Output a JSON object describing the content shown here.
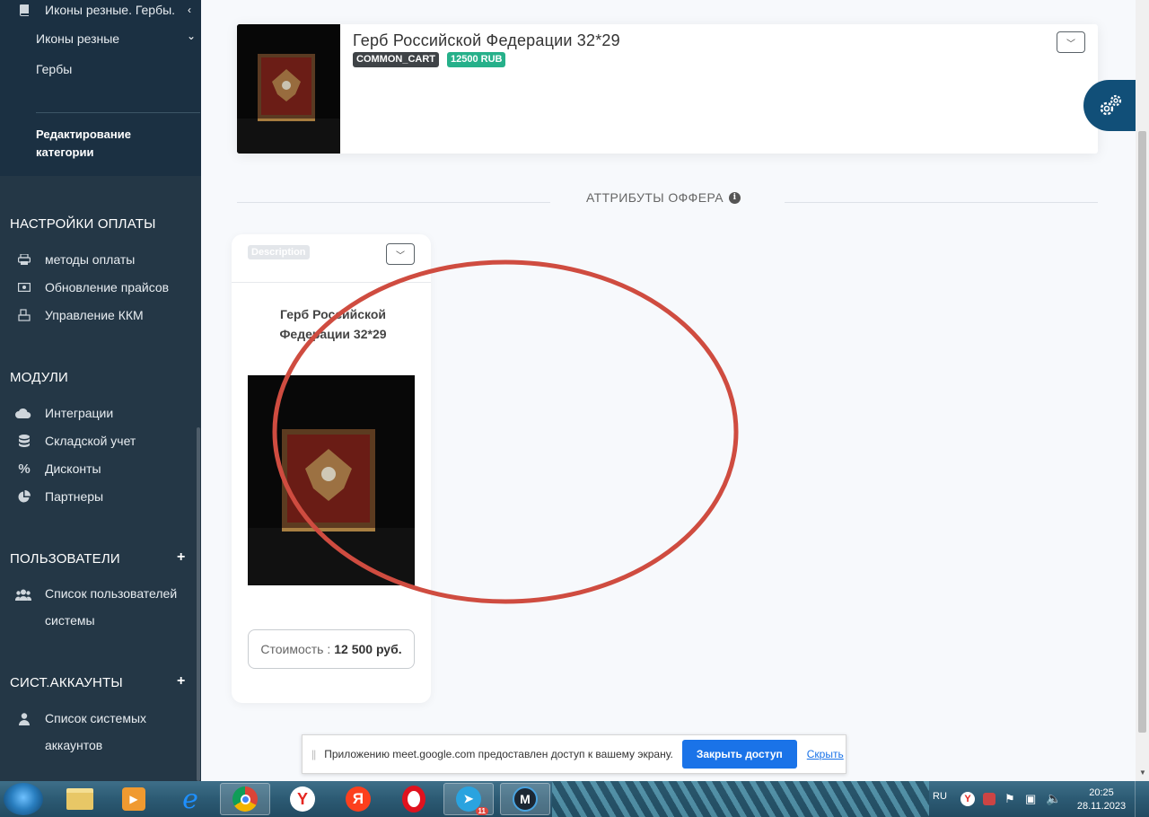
{
  "sidebar": {
    "category_title": "Иконы резные. Гербы.",
    "sub_items": [
      {
        "label": "Иконы резные"
      },
      {
        "label": "Гербы"
      }
    ],
    "edit_category": "Редактирование категории",
    "sections": [
      {
        "title": "НАСТРОЙКИ ОПЛАТЫ",
        "items": [
          {
            "label": "методы оплаты",
            "icon": "printer-icon"
          },
          {
            "label": "Обновление прайсов",
            "icon": "money-icon"
          },
          {
            "label": "Управление ККМ",
            "icon": "cash-register-icon"
          }
        ]
      },
      {
        "title": "МОДУЛИ",
        "items": [
          {
            "label": "Интеграции",
            "icon": "cloud-icon"
          },
          {
            "label": "Складской учет",
            "icon": "database-icon"
          },
          {
            "label": "Дисконты",
            "icon": "percent-icon"
          },
          {
            "label": "Партнеры",
            "icon": "pie-chart-icon"
          }
        ]
      },
      {
        "title": "ПОЛЬЗОВАТЕЛИ",
        "items": [
          {
            "label": "Список пользователей",
            "label2": "системы",
            "icon": "users-icon"
          }
        ]
      },
      {
        "title": "СИСТ.АККАУНТЫ",
        "items": [
          {
            "label": "Список системых",
            "label2": "аккаунтов",
            "icon": "user-icon"
          }
        ]
      }
    ]
  },
  "product": {
    "title": "Герб Российской Федерации 32*29",
    "badges": [
      {
        "label": "COMMON_CART",
        "color": "#3f4347"
      },
      {
        "label": "12500 RUB",
        "color": "#26b08a"
      }
    ]
  },
  "section_title": "АТТРИБУТЫ ОФФЕРА",
  "offer": {
    "tag": "Description",
    "name": "Герб Российской Федерации 32*29",
    "price_label": "Стоимость :",
    "price_value": "12 500 руб."
  },
  "screen_share": {
    "message": "Приложению meet.google.com предоставлен доступ к вашему экрану.",
    "stop_label": "Закрыть доступ",
    "hide_label": "Скрыть"
  },
  "taskbar": {
    "apps": [
      "file-explorer",
      "media-player",
      "internet-explorer",
      "chrome",
      "yandex-browser",
      "yandex",
      "opera",
      "telegram",
      "app"
    ],
    "telegram_badge": "11",
    "lang": "RU",
    "time": "20:25",
    "date": "28.11.2023"
  },
  "colors": {
    "sidebar_bg": "#243746",
    "sidebar_top_bg": "#1b3042",
    "accent_blue": "#114f78",
    "annotation_red": "#cf4c40"
  }
}
